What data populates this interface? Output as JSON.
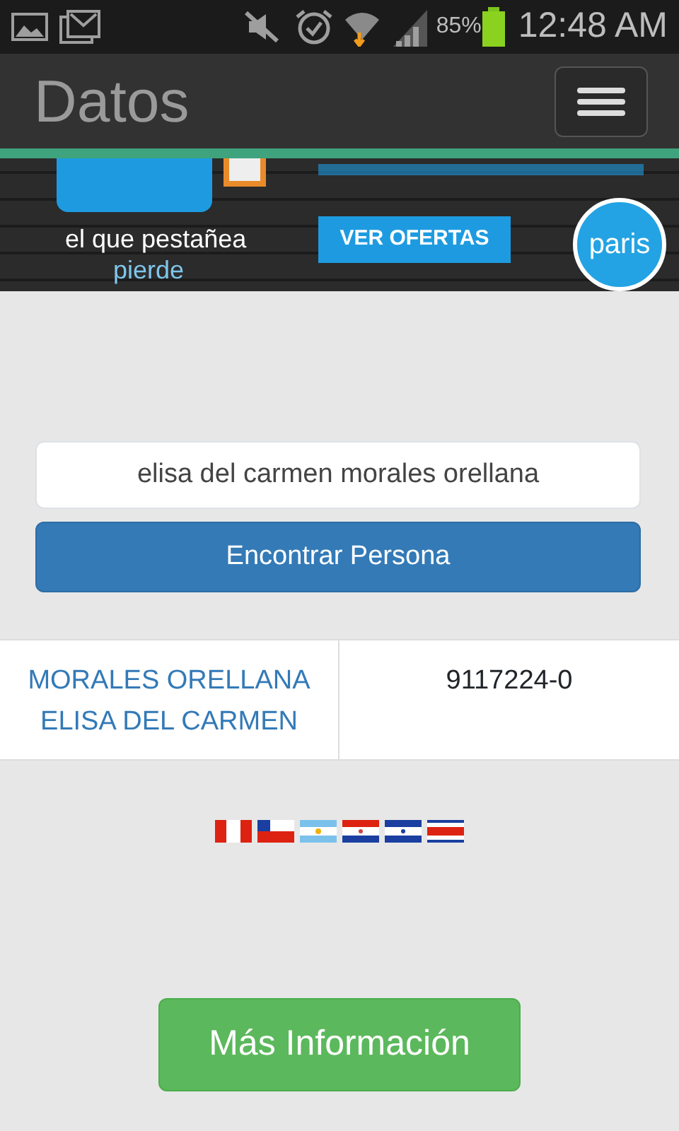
{
  "status_bar": {
    "battery": "85%",
    "time": "12:48 AM"
  },
  "navbar": {
    "title": "Datos"
  },
  "banner": {
    "kind": "picture",
    "tagline": "el que pestañea",
    "tagline_2": "pierde",
    "button": "VER OFERTAS",
    "logo": "paris"
  },
  "search": {
    "value": "elisa del carmen morales orellana",
    "button": "Encontrar Persona"
  },
  "results": [
    {
      "name": "MORALES ORELLANA ELISA DEL CARMEN",
      "id": "9117224-0"
    }
  ],
  "more_button": "Más Información"
}
